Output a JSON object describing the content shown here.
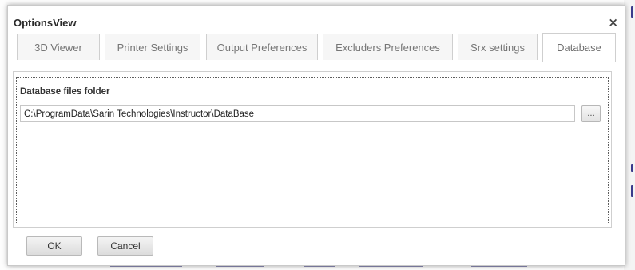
{
  "window": {
    "title": "OptionsView",
    "close_glyph": "×",
    "close_icon": "close-icon"
  },
  "tabs": [
    {
      "label": "3D Viewer",
      "active": false
    },
    {
      "label": "Printer Settings",
      "active": false
    },
    {
      "label": "Output Preferences",
      "active": false
    },
    {
      "label": "Excluders Preferences",
      "active": false
    },
    {
      "label": "Srx settings",
      "active": false
    },
    {
      "label": "Database",
      "active": true
    }
  ],
  "database": {
    "group_label": "Database files folder",
    "folder_path": "C:\\ProgramData\\Sarin Technologies\\Instructor\\DataBase",
    "browse_label": "..."
  },
  "footer": {
    "ok_label": "OK",
    "cancel_label": "Cancel"
  }
}
